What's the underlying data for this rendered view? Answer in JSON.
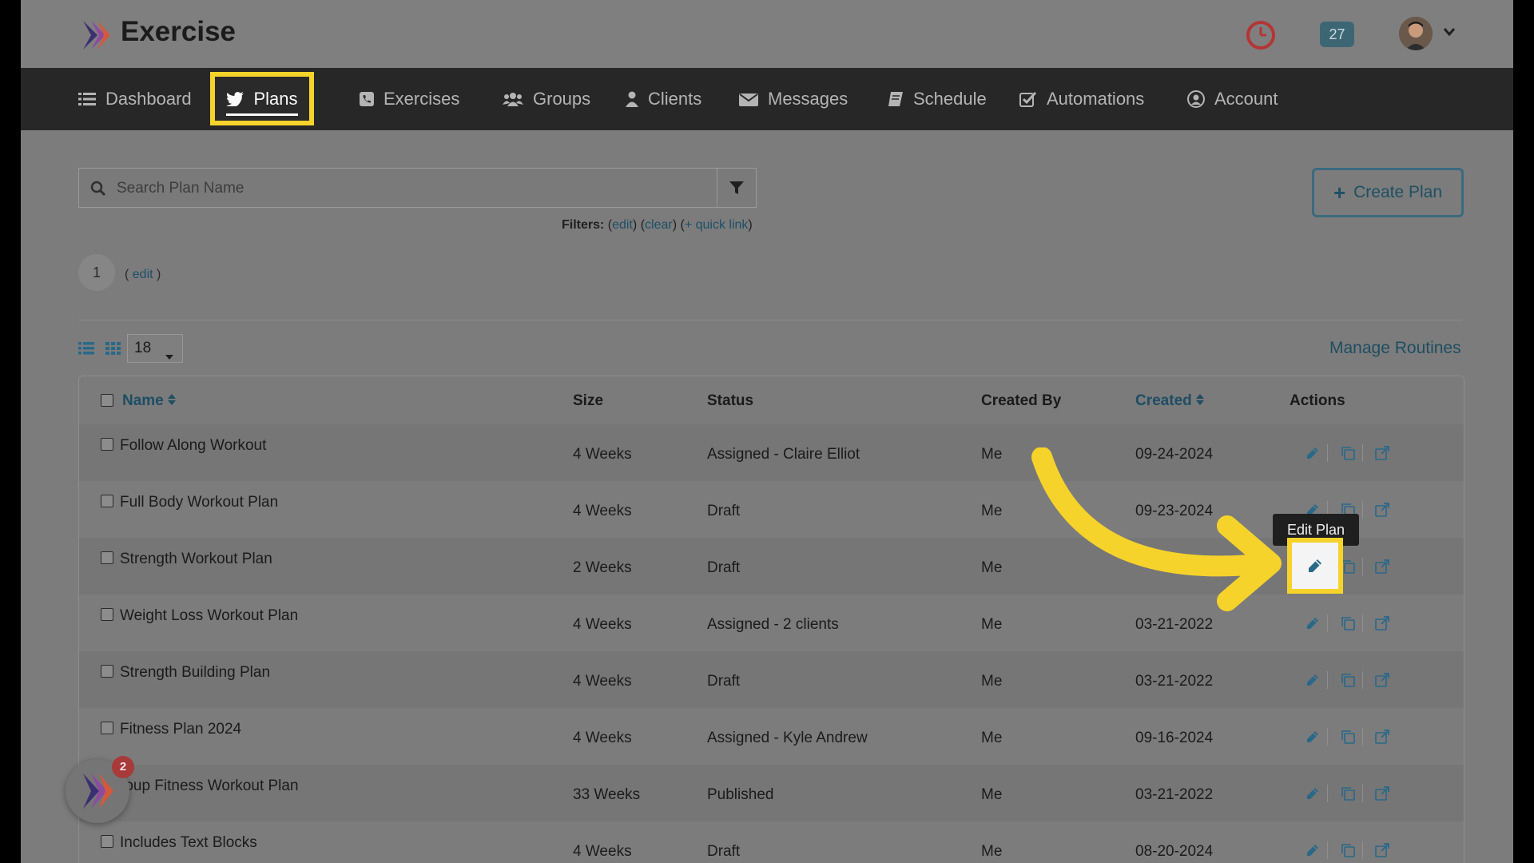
{
  "app": {
    "name": "Exercise"
  },
  "header": {
    "notification_count": "27"
  },
  "nav": {
    "items": [
      {
        "label": "Dashboard",
        "icon": "list-icon"
      },
      {
        "label": "Plans",
        "icon": "twitter-bird-icon",
        "active": true
      },
      {
        "label": "Exercises",
        "icon": "phone-square-icon"
      },
      {
        "label": "Groups",
        "icon": "users-icon"
      },
      {
        "label": "Clients",
        "icon": "user-icon"
      },
      {
        "label": "Messages",
        "icon": "envelope-icon"
      },
      {
        "label": "Schedule",
        "icon": "book-icon"
      },
      {
        "label": "Automations",
        "icon": "check-square-icon"
      },
      {
        "label": "Account",
        "icon": "user-circle-icon"
      }
    ]
  },
  "search": {
    "placeholder": "Search Plan Name"
  },
  "filters": {
    "label": "Filters:",
    "edit": "edit",
    "clear": "clear",
    "quick_link": "+ quick link"
  },
  "create_button": {
    "label": "Create Plan"
  },
  "pagination": {
    "page": "1",
    "edit_label": "edit"
  },
  "view": {
    "per_page": "18"
  },
  "manage_routines": "Manage Routines",
  "table": {
    "columns": {
      "name": "Name",
      "size": "Size",
      "status": "Status",
      "created_by": "Created By",
      "created": "Created",
      "actions": "Actions"
    },
    "rows": [
      {
        "name": "Follow Along Workout",
        "size": "4 Weeks",
        "status": "Assigned - Claire Elliot",
        "created_by": "Me",
        "created": "09-24-2024"
      },
      {
        "name": "Full Body Workout Plan",
        "size": "4 Weeks",
        "status": "Draft",
        "created_by": "Me",
        "created": "09-23-2024"
      },
      {
        "name": "Strength Workout Plan",
        "size": "2 Weeks",
        "status": "Draft",
        "created_by": "Me",
        "created": ""
      },
      {
        "name": "Weight Loss Workout Plan",
        "size": "4 Weeks",
        "status": "Assigned - 2 clients",
        "created_by": "Me",
        "created": "03-21-2022"
      },
      {
        "name": "Strength Building Plan",
        "size": "4 Weeks",
        "status": "Draft",
        "created_by": "Me",
        "created": "03-21-2022"
      },
      {
        "name": "Fitness Plan 2024",
        "size": "4 Weeks",
        "status": "Assigned - Kyle Andrew",
        "created_by": "Me",
        "created": "09-16-2024"
      },
      {
        "name": "roup Fitness Workout Plan",
        "size": "33 Weeks",
        "status": "Published",
        "created_by": "Me",
        "created": "03-21-2022"
      },
      {
        "name": "Includes Text Blocks",
        "size": "4 Weeks",
        "status": "Draft",
        "created_by": "Me",
        "created": "08-20-2024"
      }
    ]
  },
  "tooltip": {
    "text": "Edit Plan"
  },
  "chat_widget": {
    "badge": "2"
  },
  "colors": {
    "highlight": "#f5d32a",
    "link": "#1f4d62",
    "nav_bg": "#272727"
  }
}
